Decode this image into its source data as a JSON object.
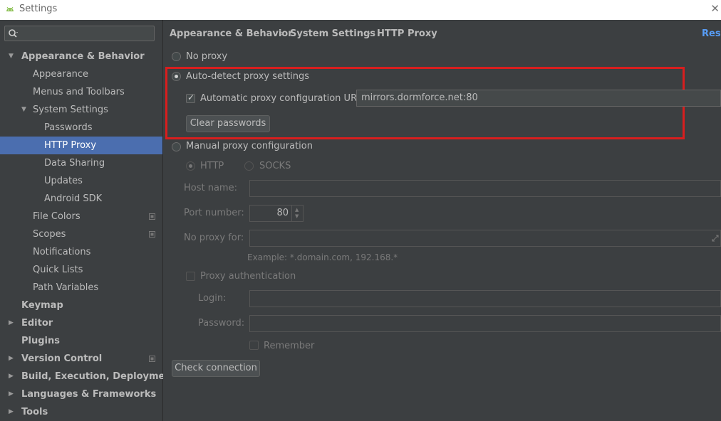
{
  "window": {
    "title": "Settings"
  },
  "sidebar": {
    "items": [
      {
        "label": "Appearance & Behavior"
      },
      {
        "label": "Appearance"
      },
      {
        "label": "Menus and Toolbars"
      },
      {
        "label": "System Settings"
      },
      {
        "label": "Passwords"
      },
      {
        "label": "HTTP Proxy"
      },
      {
        "label": "Data Sharing"
      },
      {
        "label": "Updates"
      },
      {
        "label": "Android SDK"
      },
      {
        "label": "File Colors"
      },
      {
        "label": "Scopes"
      },
      {
        "label": "Notifications"
      },
      {
        "label": "Quick Lists"
      },
      {
        "label": "Path Variables"
      },
      {
        "label": "Keymap"
      },
      {
        "label": "Editor"
      },
      {
        "label": "Plugins"
      },
      {
        "label": "Version Control"
      },
      {
        "label": "Build, Execution, Deployment"
      },
      {
        "label": "Languages & Frameworks"
      },
      {
        "label": "Tools"
      }
    ]
  },
  "breadcrumb": [
    "Appearance & Behavior",
    "System Settings",
    "HTTP Proxy"
  ],
  "reset_label": "Rese",
  "proxy": {
    "no_proxy_label": "No proxy",
    "auto_detect_label": "Auto-detect proxy settings",
    "auto_url_label": "Automatic proxy configuration URL:",
    "auto_url_value": "mirrors.dormforce.net:80",
    "clear_passwords_label": "Clear passwords",
    "manual_label": "Manual proxy configuration",
    "http_label": "HTTP",
    "socks_label": "SOCKS",
    "host_label": "Host name:",
    "host_value": "",
    "port_label": "Port number:",
    "port_value": "80",
    "no_proxy_for_label": "No proxy for:",
    "no_proxy_for_value": "",
    "example_text": "Example: *.domain.com, 192.168.*",
    "proxy_auth_label": "Proxy authentication",
    "login_label": "Login:",
    "login_value": "",
    "password_label": "Password:",
    "password_value": "",
    "remember_label": "Remember",
    "check_connection_label": "Check connection"
  },
  "colors": {
    "selection": "#4b6eaf",
    "highlight_box": "#d81e1e",
    "link": "#589df6"
  }
}
